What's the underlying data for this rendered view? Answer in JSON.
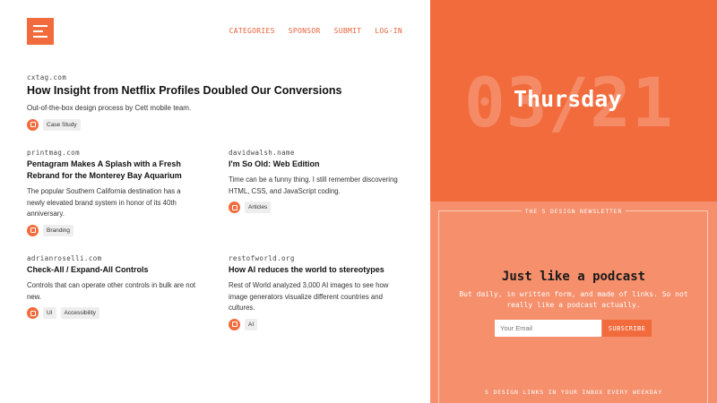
{
  "colors": {
    "accent": "#f26b3c",
    "accent_light": "#f58f6c",
    "nav_text": "#e8613a"
  },
  "logo": {
    "icon": "list-lines-icon"
  },
  "nav": {
    "items": [
      "CATEGORIES",
      "SPONSOR",
      "SUBMIT",
      "LOG-IN"
    ]
  },
  "featured": {
    "source": "cxtag.com",
    "title": "How Insight from Netflix Profiles Doubled Our Conversions",
    "description": "Out-of-the-box design process by Cett mobile team.",
    "tags": [
      "Case Study"
    ]
  },
  "articles": [
    {
      "source": "printmag.com",
      "title": "Pentagram Makes A Splash with a Fresh Rebrand for the Monterey Bay Aquarium",
      "description": "The popular Southern California destination has a newly elevated brand system in honor of its 40th anniversary.",
      "tags": [
        "Branding"
      ]
    },
    {
      "source": "davidwalsh.name",
      "title": "I'm So Old: Web Edition",
      "description": "Time can be a funny thing. I still remember discovering HTML, CSS, and JavaScript coding.",
      "tags": [
        "Articles"
      ]
    },
    {
      "source": "adrianroselli.com",
      "title": "Check-All / Expand-All Controls",
      "description": "Controls that can operate other controls in bulk are not new.",
      "tags": [
        "UI",
        "Accessibility"
      ]
    },
    {
      "source": "restofworld.org",
      "title": "How AI reduces the world to stereotypes",
      "description": "Rest of World analyzed 3,000 AI images to see how image generators visualize different countries and cultures.",
      "tags": [
        "AI"
      ]
    }
  ],
  "hero": {
    "date": "03/21",
    "day": "Thursday"
  },
  "newsletter": {
    "label": "THE 5 DESIGN NEWSLETTER",
    "title": "Just like a podcast",
    "description": "But daily, in written form, and made of links. So not really like a podcast actually.",
    "email_placeholder": "Your Email",
    "button": "SUBSCRIBE",
    "footer": "5 DESIGN LINKS IN YOUR INBOX EVERY WEEKDAY"
  }
}
